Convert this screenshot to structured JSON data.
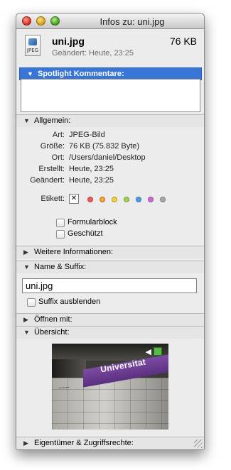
{
  "window": {
    "title": "Infos zu: uni.jpg"
  },
  "file": {
    "name": "uni.jpg",
    "size": "76 KB",
    "changed": "Geändert: Heute, 23:25",
    "icon_label": "JPEG",
    "icon": "jpeg-file-icon"
  },
  "sections": {
    "spotlight": "Spotlight Kommentare:",
    "general": "Allgemein:",
    "more_info": "Weitere Informationen:",
    "name_suffix": "Name & Suffix:",
    "open_with": "Öffnen mit:",
    "preview": "Übersicht:",
    "ownership": "Eigentümer & Zugriffsrechte:"
  },
  "general": {
    "rows": [
      {
        "label": "Art:",
        "value": "JPEG-Bild"
      },
      {
        "label": "Größe:",
        "value": "76 KB (75.832 Byte)"
      },
      {
        "label": "Ort:",
        "value": "/Users/daniel/Desktop"
      },
      {
        "label": "Erstellt:",
        "value": "Heute, 23:25"
      },
      {
        "label": "Geändert:",
        "value": "Heute, 23:25"
      }
    ],
    "label_field": "Etikett:",
    "label_clear": "✕",
    "label_colors": [
      "#f05a57",
      "#f6a135",
      "#f3d03b",
      "#9fd152",
      "#4e9de8",
      "#c86ad1",
      "#a8a8a8"
    ],
    "stationery_pad": "Formularblock",
    "locked": "Geschützt"
  },
  "name_suffix": {
    "filename": "uni.jpg",
    "hide_extension": "Suffix ausblenden"
  },
  "preview": {
    "station_sign": "Universitat"
  },
  "icons": {
    "close": "close-button-icon",
    "minimize": "minimize-button-icon",
    "zoom": "zoom-button-icon",
    "disclosure": "disclosure-triangle-icon",
    "resize": "resize-grip-icon"
  }
}
